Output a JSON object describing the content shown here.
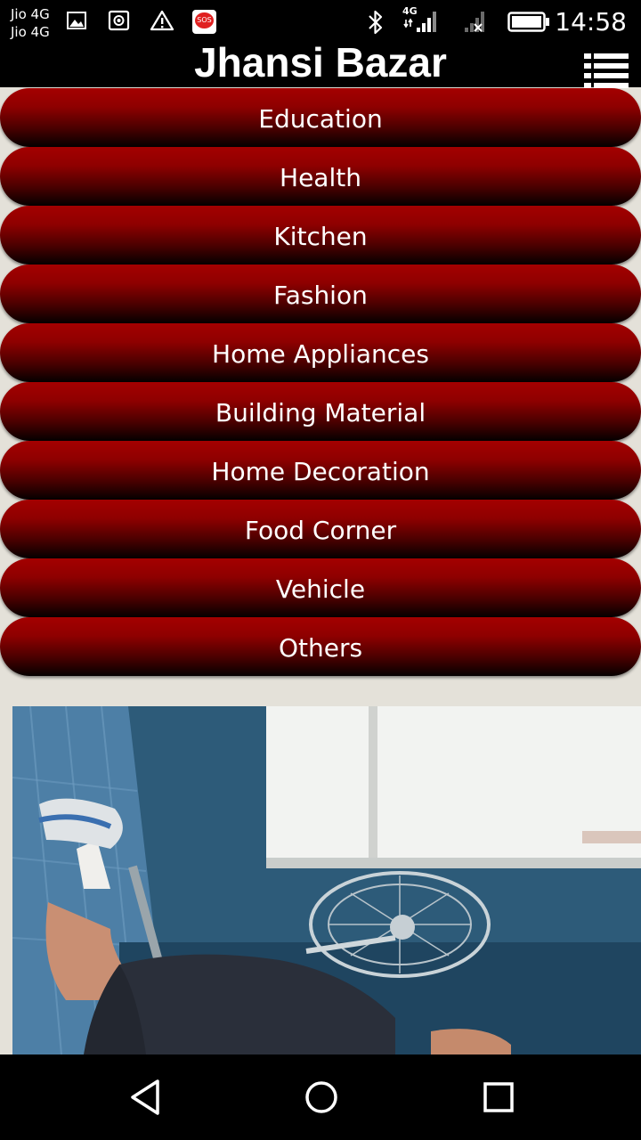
{
  "status_bar": {
    "carrier_line1": "Jio 4G",
    "carrier_line2": "Jio 4G",
    "sos_label": "SOS",
    "network_label": "4G",
    "time": "14:58"
  },
  "header": {
    "title": "Jhansi Bazar",
    "menu_icon": "list-menu-icon"
  },
  "categories": [
    {
      "label": "Education"
    },
    {
      "label": "Health"
    },
    {
      "label": "Kitchen"
    },
    {
      "label": "Fashion"
    },
    {
      "label": "Home Appliances"
    },
    {
      "label": "Building Material"
    },
    {
      "label": "Home Decoration"
    },
    {
      "label": "Food Corner"
    },
    {
      "label": "Vehicle"
    },
    {
      "label": "Others"
    }
  ],
  "colors": {
    "button_red": "#a40000",
    "button_dark": "#050000",
    "background": "#e4e1d9",
    "bar": "#000000"
  },
  "nav_bar": {
    "back_icon": "back-triangle-icon",
    "home_icon": "home-circle-icon",
    "recents_icon": "recents-square-icon"
  }
}
